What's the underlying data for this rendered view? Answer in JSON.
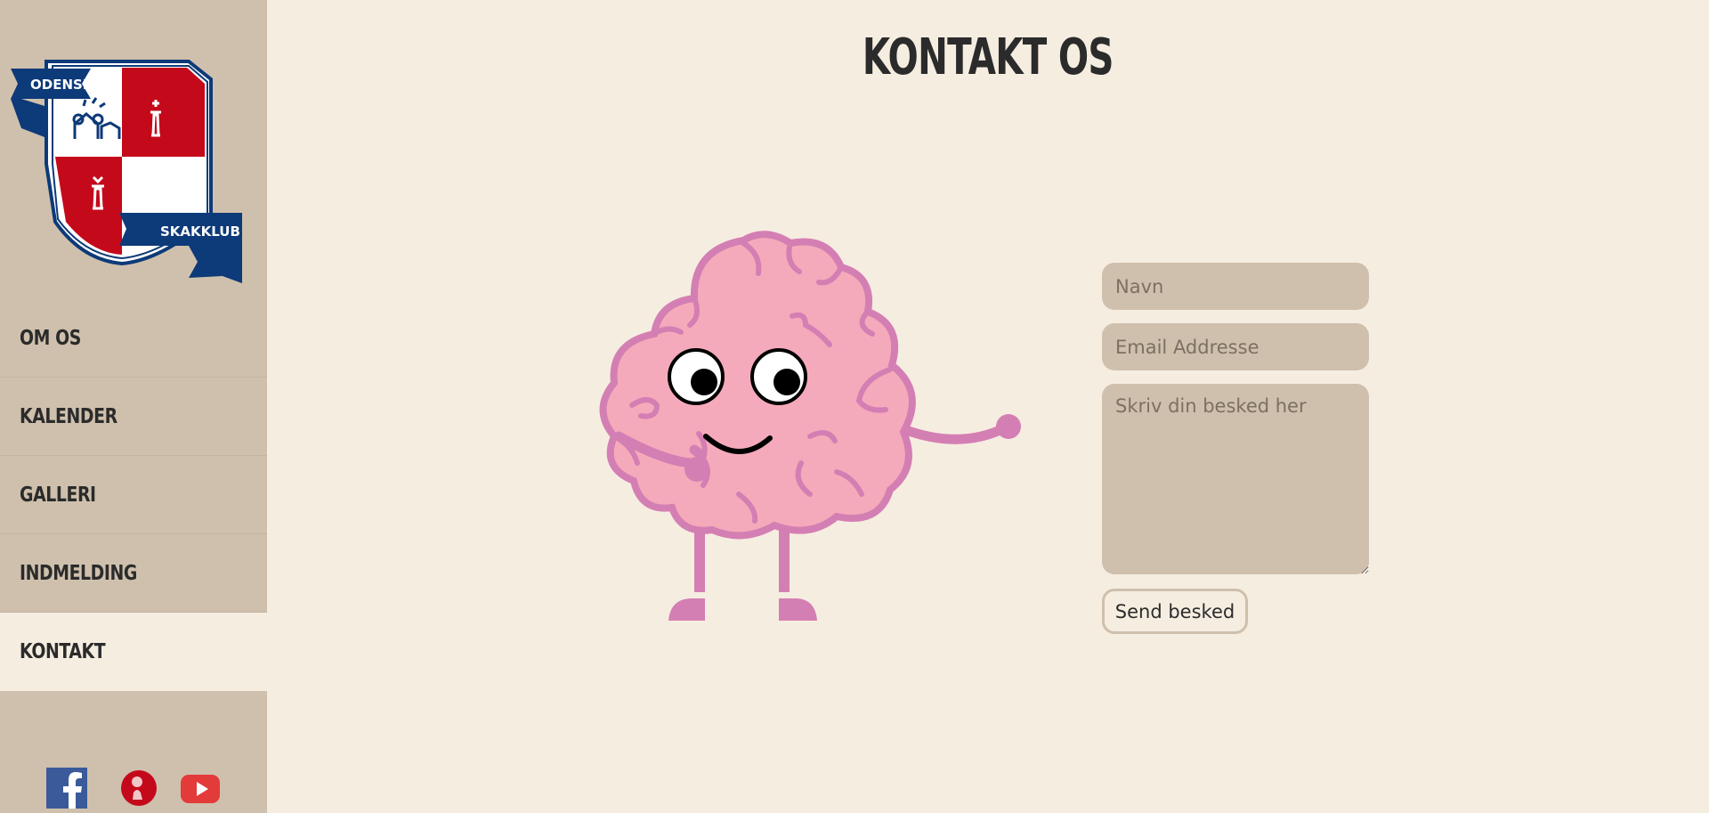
{
  "logo": {
    "top_ribbon": "ODENSE",
    "bottom_ribbon": "SKAKKLUB"
  },
  "nav": {
    "items": [
      {
        "label": "OM OS"
      },
      {
        "label": "KALENDER"
      },
      {
        "label": "GALLERI"
      },
      {
        "label": "INDMELDING"
      },
      {
        "label": "KONTAKT",
        "active": true
      }
    ]
  },
  "social": {
    "icons": [
      "facebook-icon",
      "chess-pawn-icon",
      "youtube-icon"
    ]
  },
  "page": {
    "title": "KONTAKT OS"
  },
  "form": {
    "name_placeholder": "Navn",
    "email_placeholder": "Email Addresse",
    "message_placeholder": "Skriv din besked her",
    "submit_label": "Send besked"
  },
  "colors": {
    "sidebar_bg": "#cfc0ad",
    "page_bg": "#f6ede1",
    "navy": "#0d3a78",
    "red": "#c4091b",
    "brain_pink": "#f5aabb",
    "brain_outline": "#d47fb3"
  }
}
